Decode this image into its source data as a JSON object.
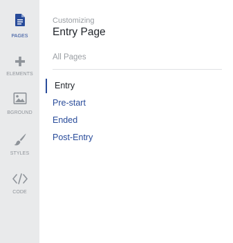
{
  "rail": {
    "items": [
      {
        "label": "PAGES",
        "icon": "document-icon",
        "active": true
      },
      {
        "label": "ELEMENTS",
        "icon": "plus-icon",
        "active": false
      },
      {
        "label": "BGROUND",
        "icon": "image-icon",
        "active": false
      },
      {
        "label": "STYLES",
        "icon": "brush-icon",
        "active": false
      },
      {
        "label": "CODE",
        "icon": "code-icon",
        "active": false
      }
    ]
  },
  "panel": {
    "eyebrow": "Customizing",
    "title": "Entry Page",
    "all_pages_label": "All Pages",
    "pages": [
      {
        "label": "Entry",
        "active": true
      },
      {
        "label": "Pre-start",
        "active": false
      },
      {
        "label": "Ended",
        "active": false
      },
      {
        "label": "Post-Entry",
        "active": false
      }
    ]
  },
  "colors": {
    "accent": "#284b9a",
    "rail_background": "#e9eaeb",
    "muted_text": "#9a9ea3",
    "heading_text": "#1f2329",
    "icon_gray": "#8e9399"
  }
}
